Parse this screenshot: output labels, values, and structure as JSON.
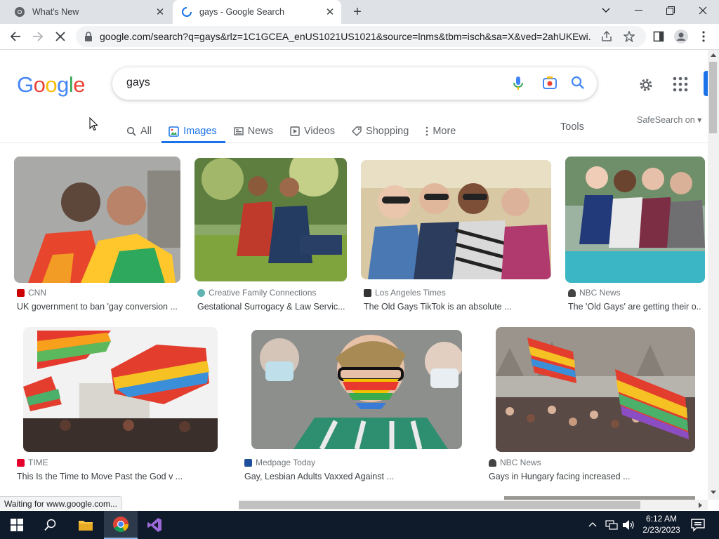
{
  "browser": {
    "tabs": [
      {
        "title": "What's New",
        "icon": "chrome-icon"
      },
      {
        "title": "gays - Google Search",
        "icon": "loading-spinner-icon"
      }
    ],
    "url": "google.com/search?q=gays&rlz=1C1GCEA_enUS1021US1021&source=lnms&tbm=isch&sa=X&ved=2ahUKEwi...",
    "status": "Waiting for www.google.com..."
  },
  "google": {
    "logo": "Google",
    "query": "gays",
    "tabs": [
      "All",
      "Images",
      "News",
      "Videos",
      "Shopping",
      "More"
    ],
    "active_tab": "Images",
    "tools": "Tools",
    "safesearch": "SafeSearch on"
  },
  "results": [
    {
      "source": "CNN",
      "title": "UK government to ban 'gay conversion ...",
      "fav": "#cc0000"
    },
    {
      "source": "Creative Family Connections",
      "title": "Gestational Surrogacy & Law Servic...",
      "fav": "#5fb3b3"
    },
    {
      "source": "Los Angeles Times",
      "title": "The Old Gays TikTok is an absolute ...",
      "fav": "#333333"
    },
    {
      "source": "NBC News",
      "title": "The 'Old Gays' are getting their o...",
      "fav": "#444444"
    },
    {
      "source": "TIME",
      "title": "This Is the Time to Move Past the God v ...",
      "fav": "#e4002b"
    },
    {
      "source": "Medpage Today",
      "title": "Gay, Lesbian Adults Vaxxed Against ...",
      "fav": "#1f4e9c"
    },
    {
      "source": "NBC News",
      "title": "Gays in Hungary facing increased ...",
      "fav": "#444444"
    }
  ],
  "taskbar": {
    "time": "6:12 AM",
    "date": "2/23/2023"
  },
  "colors": {
    "accent": "#1a73e8",
    "tabbar": "#dee1e6",
    "taskbar": "#0f1a2a"
  }
}
